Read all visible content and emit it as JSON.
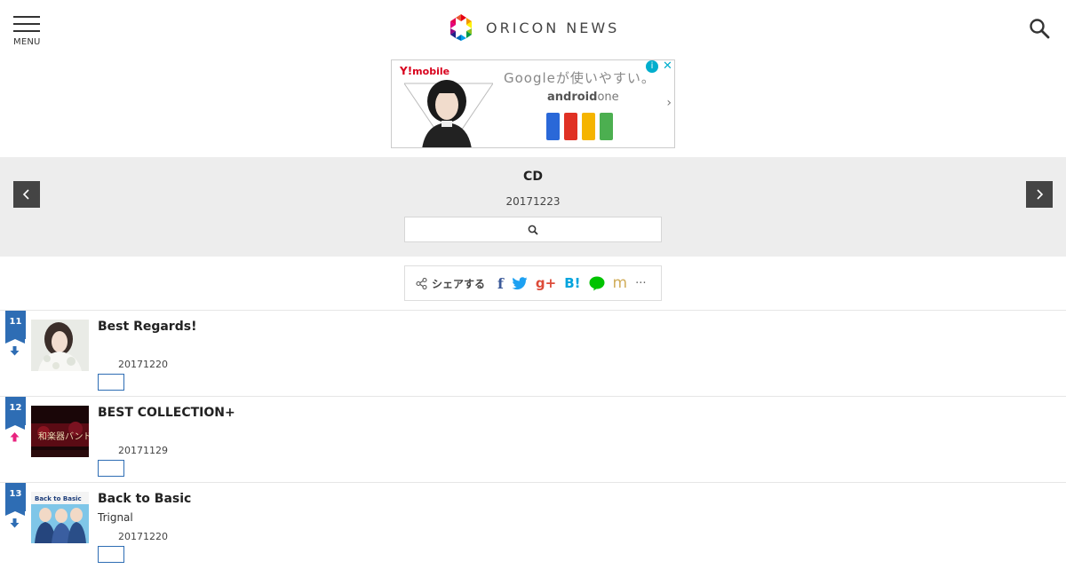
{
  "header": {
    "menu_label": "MENU",
    "logo_text": "ORICON NEWS"
  },
  "ad": {
    "brand": "Y!",
    "brand_suffix": "mobile",
    "headline": "Googleが使いやすい。",
    "product": "android",
    "product_suffix": "one",
    "chevron": "›",
    "info": "i",
    "close": "✕"
  },
  "chart": {
    "title": "CD",
    "date": "20171223"
  },
  "share": {
    "label": "シェアする",
    "facebook": "f",
    "googleplus": "g+",
    "hatena": "B!",
    "mixi": "m",
    "more": "···"
  },
  "rankings": [
    {
      "rank": "11",
      "trend": "down",
      "title": "Best Regards!",
      "artist": "",
      "date": "20171220"
    },
    {
      "rank": "12",
      "trend": "up",
      "title": " BEST COLLECTION+",
      "artist": "",
      "date": "20171129"
    },
    {
      "rank": "13",
      "trend": "down",
      "title": "Back to Basic",
      "artist": "Trignal",
      "date": "20171220"
    }
  ],
  "colors": {
    "rank_blue": "#2e6db4",
    "trend_down": "#2e6db4",
    "trend_up": "#e8237f",
    "gray_band": "#ededed"
  }
}
